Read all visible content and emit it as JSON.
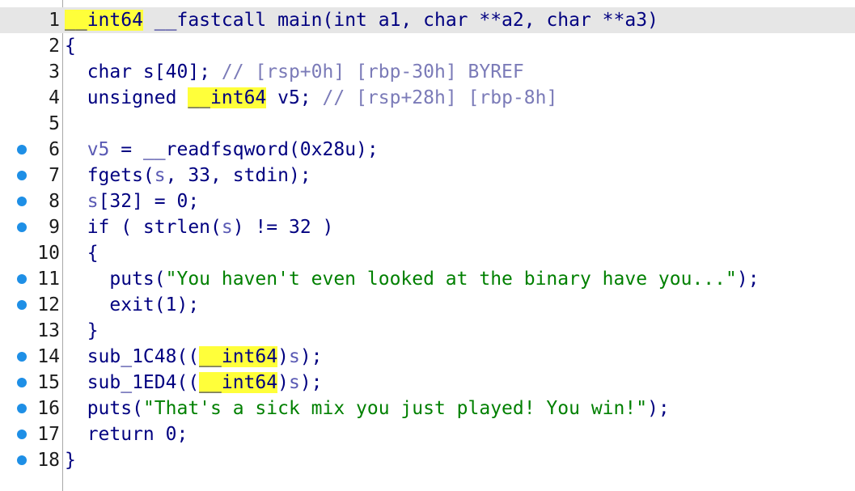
{
  "editor": {
    "title": "pseudocode-view",
    "lines": [
      {
        "no": "1",
        "bp": false,
        "current": true,
        "tokens": [
          {
            "t": "",
            "c": "p"
          },
          {
            "t": "__int64",
            "c": "k",
            "hl": true
          },
          {
            "t": " ",
            "c": "p"
          },
          {
            "t": "__fastcall main(int a1, char **a2, char **a3)",
            "c": "k"
          }
        ]
      },
      {
        "no": "2",
        "bp": false,
        "tokens": [
          {
            "t": "{",
            "c": "k"
          }
        ]
      },
      {
        "no": "3",
        "bp": false,
        "tokens": [
          {
            "t": "  char s[40]; ",
            "c": "k"
          },
          {
            "t": "// [rsp+0h] [rbp-30h] BYREF",
            "c": "c"
          }
        ]
      },
      {
        "no": "4",
        "bp": false,
        "tokens": [
          {
            "t": "  unsigned ",
            "c": "k"
          },
          {
            "t": "__int64",
            "c": "k",
            "hl": true
          },
          {
            "t": " v5; ",
            "c": "k"
          },
          {
            "t": "// [rsp+28h] [rbp-8h]",
            "c": "c"
          }
        ]
      },
      {
        "no": "5",
        "bp": false,
        "tokens": []
      },
      {
        "no": "6",
        "bp": true,
        "tokens": [
          {
            "t": "  ",
            "c": "k"
          },
          {
            "t": "v5",
            "c": "v"
          },
          {
            "t": " = __readfsqword(0x28u);",
            "c": "k"
          }
        ]
      },
      {
        "no": "7",
        "bp": true,
        "tokens": [
          {
            "t": "  fgets(",
            "c": "k"
          },
          {
            "t": "s",
            "c": "v"
          },
          {
            "t": ", 33, stdin);",
            "c": "k"
          }
        ]
      },
      {
        "no": "8",
        "bp": true,
        "tokens": [
          {
            "t": "  ",
            "c": "k"
          },
          {
            "t": "s",
            "c": "v"
          },
          {
            "t": "[32] = 0;",
            "c": "k"
          }
        ]
      },
      {
        "no": "9",
        "bp": true,
        "tokens": [
          {
            "t": "  if ( strlen(",
            "c": "k"
          },
          {
            "t": "s",
            "c": "v"
          },
          {
            "t": ") != 32 )",
            "c": "k"
          }
        ]
      },
      {
        "no": "10",
        "bp": false,
        "tokens": [
          {
            "t": "  {",
            "c": "k"
          }
        ]
      },
      {
        "no": "11",
        "bp": true,
        "tokens": [
          {
            "t": "    puts(",
            "c": "k"
          },
          {
            "t": "\"You haven't even looked at the binary have you...\"",
            "c": "s"
          },
          {
            "t": ");",
            "c": "k"
          }
        ]
      },
      {
        "no": "12",
        "bp": true,
        "tokens": [
          {
            "t": "    exit(1);",
            "c": "k"
          }
        ]
      },
      {
        "no": "13",
        "bp": false,
        "tokens": [
          {
            "t": "  }",
            "c": "k"
          }
        ]
      },
      {
        "no": "14",
        "bp": true,
        "tokens": [
          {
            "t": "  sub_1C48((",
            "c": "k"
          },
          {
            "t": "__int64",
            "c": "k",
            "hl": true
          },
          {
            "t": ")",
            "c": "k"
          },
          {
            "t": "s",
            "c": "v"
          },
          {
            "t": ");",
            "c": "k"
          }
        ]
      },
      {
        "no": "15",
        "bp": true,
        "tokens": [
          {
            "t": "  sub_1ED4((",
            "c": "k"
          },
          {
            "t": "__int64",
            "c": "k",
            "hl": true
          },
          {
            "t": ")",
            "c": "k"
          },
          {
            "t": "s",
            "c": "v"
          },
          {
            "t": ");",
            "c": "k"
          }
        ]
      },
      {
        "no": "16",
        "bp": true,
        "tokens": [
          {
            "t": "  puts(",
            "c": "k"
          },
          {
            "t": "\"That's a sick mix you just played! You win!\"",
            "c": "s"
          },
          {
            "t": ");",
            "c": "k"
          }
        ]
      },
      {
        "no": "17",
        "bp": true,
        "tokens": [
          {
            "t": "  return 0;",
            "c": "k"
          }
        ]
      },
      {
        "no": "18",
        "bp": true,
        "tokens": [
          {
            "t": "}",
            "c": "k"
          }
        ]
      }
    ]
  },
  "colors": {
    "keyword": "#000080",
    "variable": "#5a5ab4",
    "comment": "#7b7bb8",
    "string": "#008000",
    "highlight": "#ffff3a",
    "breakpoint_dot": "#1e8fe6"
  }
}
